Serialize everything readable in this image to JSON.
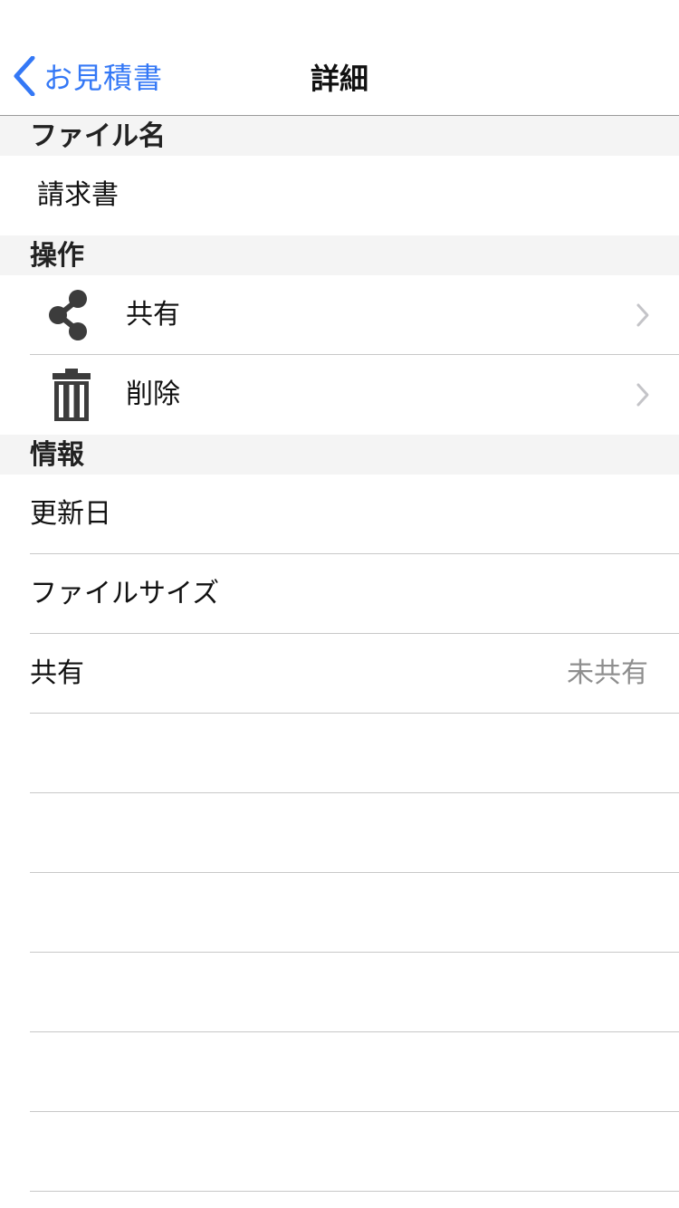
{
  "navbar": {
    "back_label": "お見積書",
    "title": "詳細"
  },
  "sections": {
    "filename": {
      "header": "ファイル名",
      "value": "請求書"
    },
    "operations": {
      "header": "操作",
      "share_label": "共有",
      "delete_label": "削除"
    },
    "info": {
      "header": "情報",
      "updated_label": "更新日",
      "filesize_label": "ファイルサイズ",
      "share_label": "共有",
      "share_value": "未共有"
    }
  },
  "icons": {
    "back": "chevron-left-icon",
    "share": "share-icon",
    "delete": "trash-icon",
    "disclosure": "chevron-right-icon"
  },
  "colors": {
    "accent": "#3478f6",
    "icon": "#3c3c3c",
    "section_bg": "#f4f4f4",
    "separator": "#c8c8c8",
    "secondary_text": "#8e8e8e"
  }
}
